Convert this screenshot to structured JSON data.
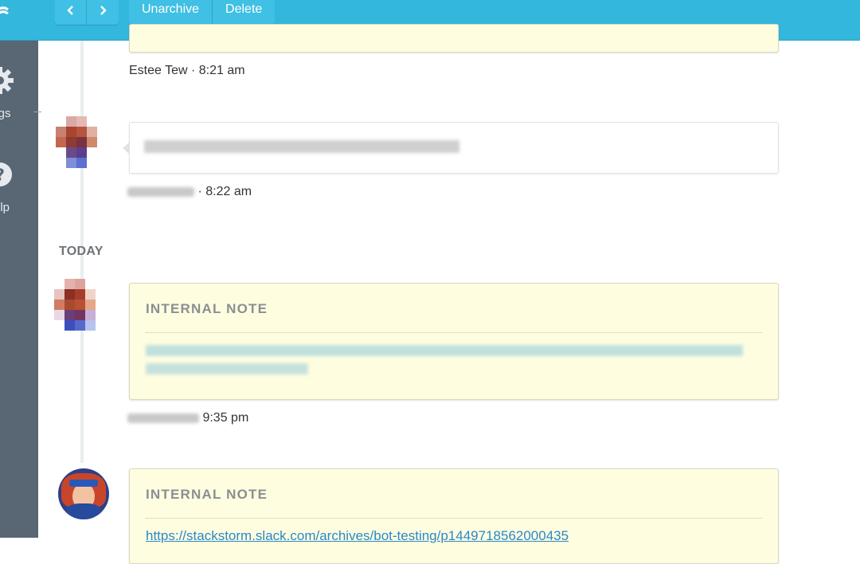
{
  "toolbar": {
    "back_icon": "chevron-left-icon",
    "forward_icon": "chevron-right-icon",
    "unarchive_label": "Unarchive",
    "delete_label": "Delete"
  },
  "sidebar": {
    "settings_label": "ings",
    "help_label": "elp"
  },
  "conversation": {
    "items": [
      {
        "author": "Estee Tew",
        "time": "8:21 am",
        "meta": "Estee Tew · 8:21 am"
      },
      {
        "type": "message",
        "time_meta": "· 8:22 am"
      },
      {
        "type": "internal_note",
        "title": "INTERNAL NOTE",
        "time_meta": "9:35 pm"
      },
      {
        "type": "internal_note",
        "title": "INTERNAL NOTE",
        "link": "https://stackstorm.slack.com/archives/bot-testing/p1449718562000435"
      }
    ],
    "day_divider": "TODAY"
  },
  "colors": {
    "topbar": "#34b7dc",
    "sidebar": "#596673",
    "note_background": "#fffde0",
    "link": "#2a88c9"
  }
}
